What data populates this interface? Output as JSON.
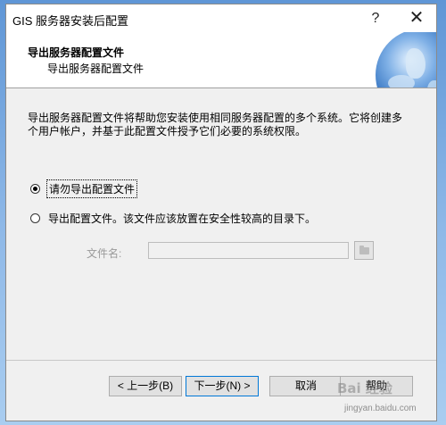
{
  "window": {
    "title": "GIS 服务器安装后配置"
  },
  "titlebar": {
    "help": "?",
    "close": "✕"
  },
  "header": {
    "title": "导出服务器配置文件",
    "subtitle": "导出服务器配置文件"
  },
  "description": "导出服务器配置文件将帮助您安装使用相同服务器配置的多个系统。它将创建多个用户帐户，并基于此配置文件授予它们必要的系统权限。",
  "options": [
    {
      "label": "请勿导出配置文件",
      "selected": true
    },
    {
      "label": "导出配置文件。该文件应该放置在安全性较高的目录下。",
      "selected": false
    }
  ],
  "file": {
    "label": "文件名:",
    "value": ""
  },
  "buttons": {
    "back": "< 上一步(B)",
    "next": "下一步(N) >",
    "cancel": "取消",
    "help": "帮助"
  },
  "watermark": {
    "text": "Bai 经验",
    "url": "jingyan.baidu.com"
  }
}
